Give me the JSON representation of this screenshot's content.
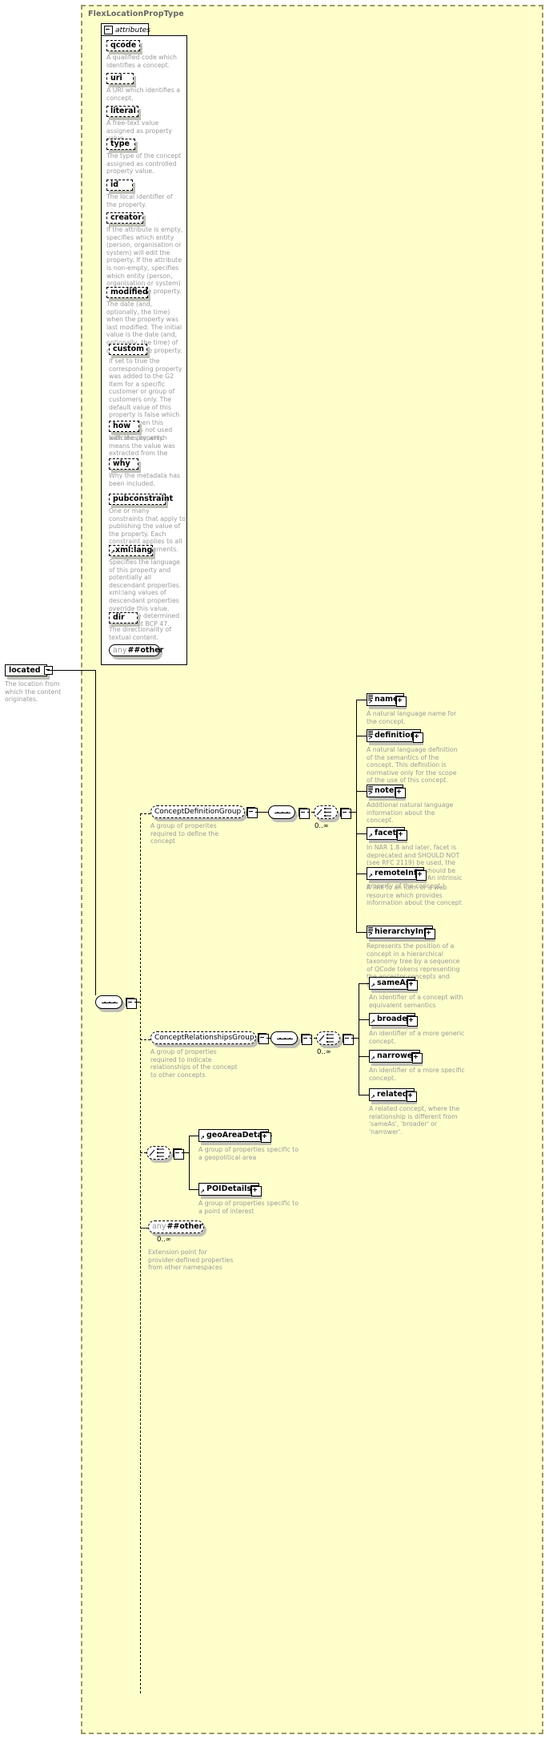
{
  "diagram": {
    "kind": "xsd-schema-diagram",
    "type_title": "FlexLocationPropType",
    "colors": {
      "type_fill": "#ffffcc",
      "type_border": "#999966",
      "doc_text": "#999999",
      "title_text": "#666666",
      "shadow": "#b5b5a8",
      "node_fill": "#ffffff",
      "line": "#000000"
    }
  },
  "root_element": {
    "name": "located",
    "icon": "collapse-minus-icon",
    "doc": "The location from which the content originates."
  },
  "attributes_panel": {
    "tab_label": "attributes",
    "tab_icon": "collapse-minus-icon",
    "items": [
      {
        "name": "qcode",
        "doc": "A qualified code which identifies a concept."
      },
      {
        "name": "uri",
        "doc": "A URI which identifies a concept."
      },
      {
        "name": "literal",
        "doc": "A free-text value assigned as property value."
      },
      {
        "name": "type",
        "doc": "The type of the concept assigned as controlled property value."
      },
      {
        "name": "id",
        "doc": "The local identifier of the property."
      },
      {
        "name": "creator",
        "doc": "If the attribute is empty, specifies which entity (person, organisation or system) will edit the property. If the attribute is non-empty, specifies which entity (person, organisation or system) has edited the property."
      },
      {
        "name": "modified",
        "doc": "The date (and, optionally, the time) when the property was last modified. The initial value is the date (and, optionally, the time) of creation of the property."
      },
      {
        "name": "custom",
        "doc": "If set to true the corresponding property was added to the G2 Item for a specific customer or group of customers only. The default value of this property is false which applies when this attribute is not used with the property."
      },
      {
        "name": "how",
        "doc": "Indicates by which means the value was extracted from the content."
      },
      {
        "name": "why",
        "doc": "Why the metadata has been included."
      },
      {
        "name": "pubconstraint",
        "doc": "One or many constraints that apply to publishing the value of the property. Each constraint applies to all descendant elements."
      },
      {
        "name": "xml:lang",
        "doc": "Specifies the language of this property and potentially all descendant properties. xml:lang values of descendant properties override this value. Values are determined by Internet BCP 47."
      },
      {
        "name": "dir",
        "doc": "The directionality of textual content."
      }
    ],
    "any": {
      "prefix": "any",
      "name": "##other"
    }
  },
  "content_model": {
    "root_compositor": "sequence",
    "branches": [
      {
        "group": {
          "name": "ConceptDefinitionGroup",
          "icon": "collapse-minus-icon",
          "doc": "A group of properites required to define the concept"
        },
        "compositor": "sequence",
        "choice_occurrence": "0..∞",
        "children": [
          {
            "name": "name",
            "icon": "element-icon",
            "expand": "expand-plus-icon",
            "doc": "A natural language name for the concept."
          },
          {
            "name": "definition",
            "icon": "element-icon",
            "expand": "expand-plus-icon",
            "doc": "A natural language definition of the semantics of the concept. This definition is normative only for the scope of the use of this concept."
          },
          {
            "name": "note",
            "icon": "element-icon",
            "expand": "expand-plus-icon",
            "doc": "Additional natural language information about the concept."
          },
          {
            "name": "facet",
            "icon": "element-icon",
            "expand": "expand-plus-icon",
            "doc": "In NAR 1.8 and later, facet is deprecated and SHOULD NOT (see RFC 2119) be used, the \"related\" property should be used instead (was: An intrinsic property of the concept.)"
          },
          {
            "name": "remoteInfo",
            "icon": "element-icon",
            "expand": "expand-plus-icon",
            "doc": "A link to an item or a web resource which provides information about the concept"
          },
          {
            "name": "hierarchyInfo",
            "icon": "element-icon",
            "expand": "expand-plus-icon",
            "doc": "Represents the position of a concept in a hierarchical taxonomy tree by a sequence of QCode tokens representing the ancestor concepts and this concept"
          }
        ]
      },
      {
        "group": {
          "name": "ConceptRelationshipsGroup",
          "icon": "collapse-minus-icon",
          "doc": "A group of properties required to indicate relationships of the concept to other concepts"
        },
        "compositor": "sequence",
        "choice_occurrence": "0..∞",
        "children": [
          {
            "name": "sameAs",
            "icon": "element-icon",
            "expand": "expand-plus-icon",
            "doc": "An identifier of a concept with equivalent semantics"
          },
          {
            "name": "broader",
            "icon": "element-icon",
            "expand": "expand-plus-icon",
            "doc": "An identifier of a more generic concept."
          },
          {
            "name": "narrower",
            "icon": "element-icon",
            "expand": "expand-plus-icon",
            "doc": "An identifier of a more specific concept."
          },
          {
            "name": "related",
            "icon": "element-icon",
            "expand": "expand-plus-icon",
            "doc": "A related concept, where the relationship is different from 'sameAs', 'broader' or 'narrower'."
          }
        ]
      },
      {
        "compositor": "choice",
        "children": [
          {
            "name": "geoAreaDetails",
            "icon": "element-icon",
            "expand": "expand-plus-icon",
            "doc": "A group of properties specific to a geopolitical area"
          },
          {
            "name": "POIDetails",
            "icon": "element-icon",
            "expand": "expand-plus-icon",
            "doc": "A group of properties specific to a point of interest"
          }
        ]
      },
      {
        "any": {
          "prefix": "any",
          "name": "##other",
          "occurrence": "0..∞",
          "doc": "Extension point for provider-defined properties from other namespaces"
        }
      }
    ]
  }
}
